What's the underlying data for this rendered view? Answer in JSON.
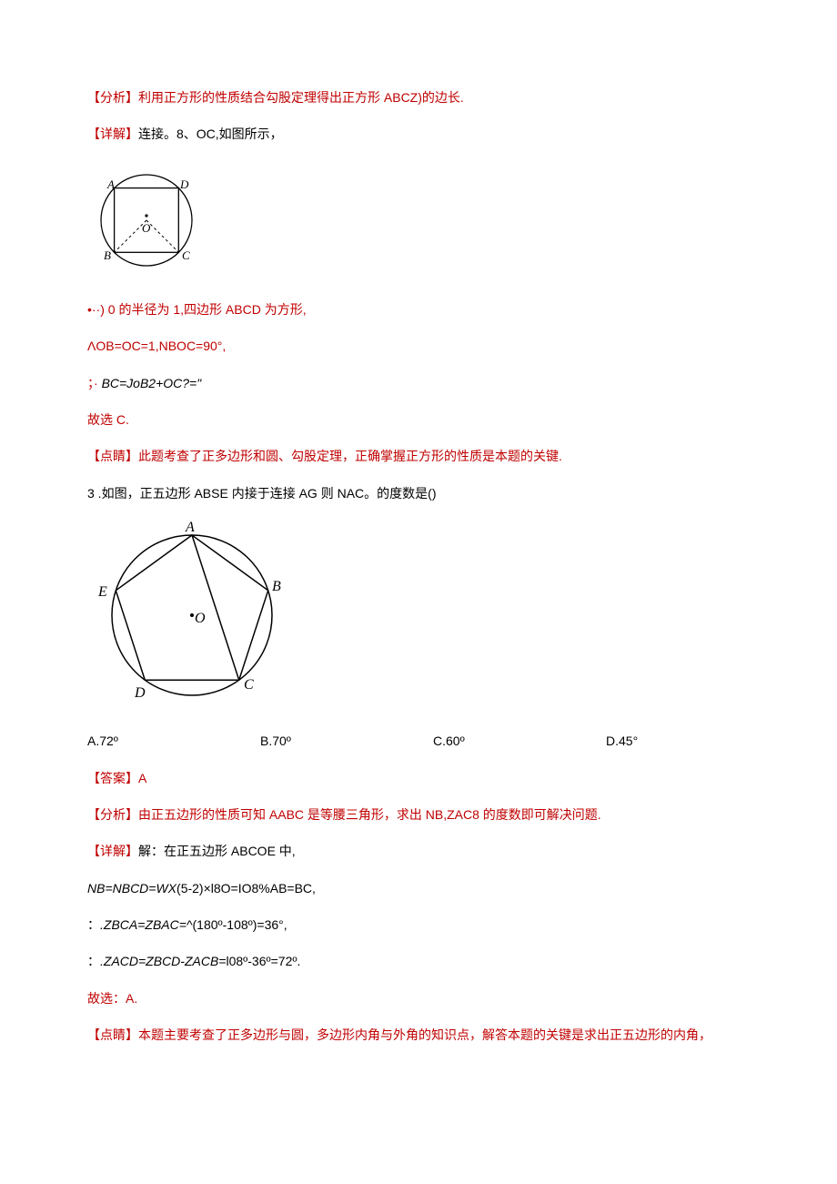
{
  "q2": {
    "analysis_label": "【分析】",
    "analysis_text": "利用正方形的性质结合勾股定理得出正方形 ABCZ)的边长.",
    "detail_label": "【详解】",
    "detail_text": "连接。8、OC,如图所示，",
    "fig_labels": {
      "A": "A",
      "B": "B",
      "C": "C",
      "D": "D",
      "O": "O"
    },
    "line1": "•··) 0 的半径为 1,四边形 ABCD 为方形,",
    "line2": "ΛOB=OC=1,NBOC=90°,",
    "line3_prefix": "；·",
    "line3_ital": "BC=JoB2+OC?=\"",
    "conclusion": "故选 C.",
    "hint_label": "【点睛】",
    "hint_text": "此题考查了正多边形和圆、勾股定理，正确掌握正方形的性质是本题的关键."
  },
  "q3": {
    "number": "3",
    "stem": " .如图，正五边形 ABSE 内接于连接 AG 则 NAC。的度数是()",
    "fig_labels": {
      "A": "A",
      "B": "B",
      "C": "C",
      "D": "D",
      "E": "E",
      "O": "O"
    },
    "options": {
      "A": "A.72º",
      "B": "B.70º",
      "C": "C.60º",
      "D": "D.45°"
    },
    "answer_label": "【答案】",
    "answer_value": "A",
    "analysis_label": "【分析】",
    "analysis_text": "由正五边形的性质可知 AABC 是等腰三角形，求出 NB,ZAC8 的度数即可解决问题.",
    "detail_label": "【详解】",
    "detail_text": "解：在正五边形 ABCOE 中,",
    "line1_ital": "NB=NBCD=WX",
    "line1_rest": "(5-2)×l8O=IO8%AB=BC,",
    "line2_prefix": "：",
    "line2_ital": ".ZBCA=ZBAC=^",
    "line2_rest": "(180º-108º)=36°,",
    "line3_prefix": "：",
    "line3_ital": ".ZACD=ZBCD-ZACB=",
    "line3_rest": "l08º-36º=72º.",
    "conclusion": "故选：A.",
    "hint_label": "【点睛】",
    "hint_text": "本题主要考查了正多边形与圆，多边形内角与外角的知识点，解答本题的关键是求出正五边形的内角，"
  }
}
